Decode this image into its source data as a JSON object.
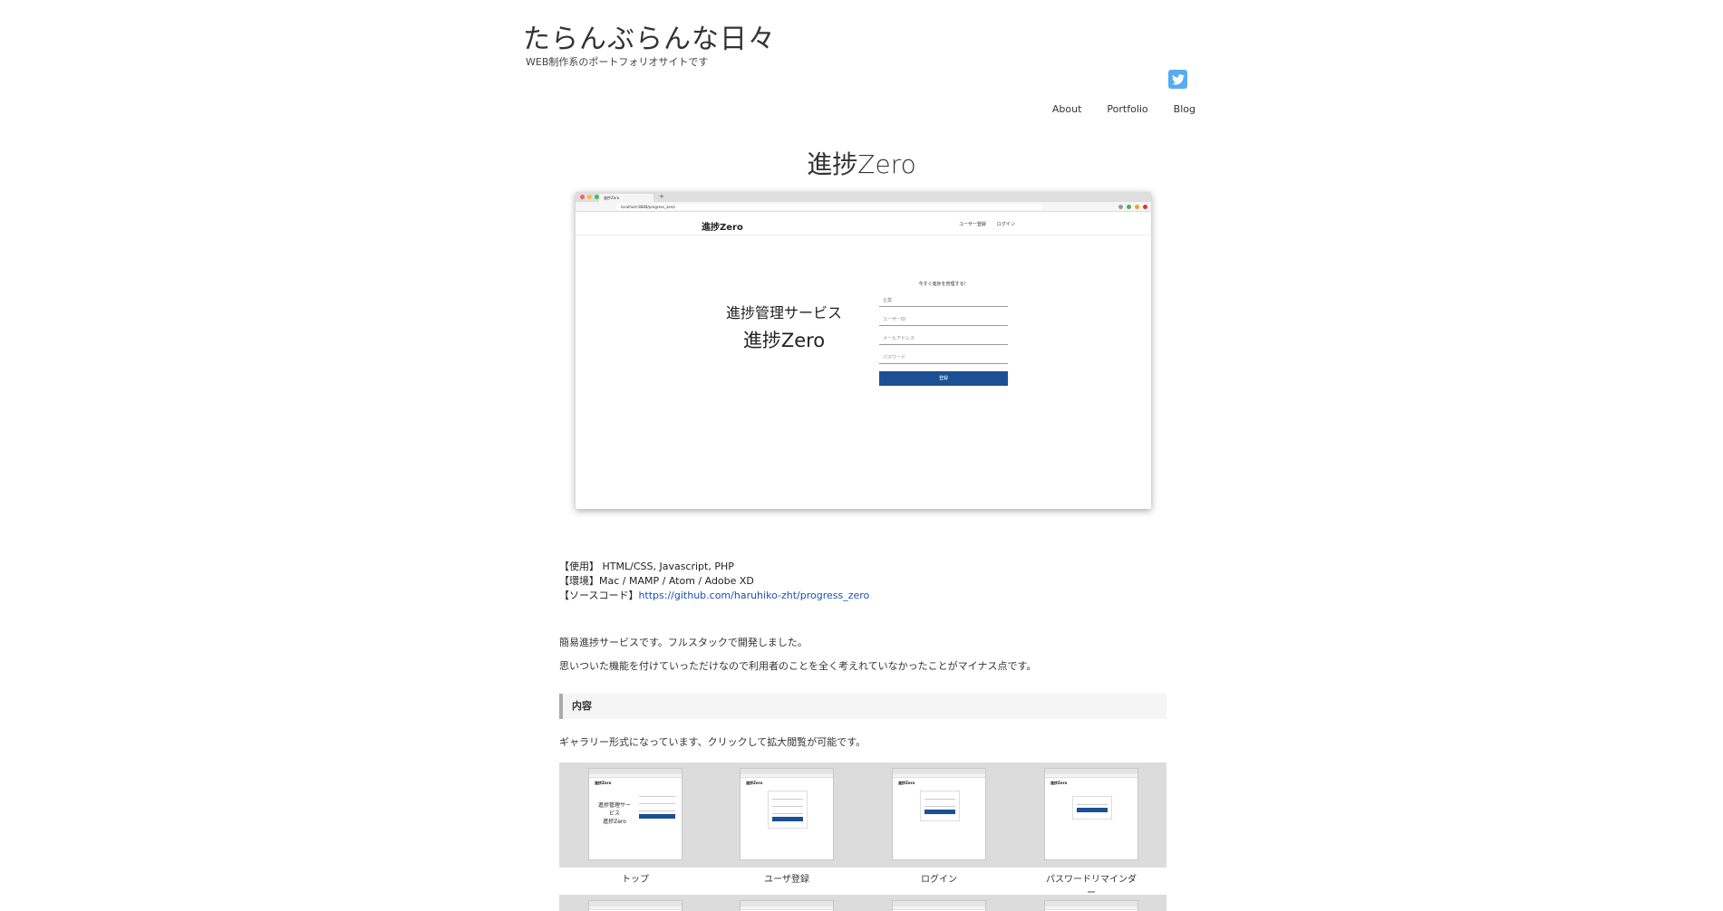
{
  "site": {
    "title": "たらんぶらんな日々",
    "description": "WEB制作系のポートフォリオサイトです"
  },
  "social": {
    "twitter_icon": "twitter-icon",
    "color": "#55acee"
  },
  "nav": {
    "items": [
      {
        "label": "About"
      },
      {
        "label": "Portfolio"
      },
      {
        "label": "Blog"
      }
    ]
  },
  "page": {
    "title": "進捗Zero"
  },
  "hero": {
    "tab_title": "進捗Zero",
    "url": "localhost:8888/progress_zero/",
    "app_logo": "進捗Zero",
    "app_nav": [
      "ユーザー登録",
      "ログイン"
    ],
    "subtitle": "進捗管理サービス",
    "headline": "進捗Zero",
    "form_title": "今すぐ進捗を管理する！",
    "fields": [
      "企業",
      "ユーザーID",
      "メールアドレス",
      "パスワード"
    ],
    "submit_label": "登録"
  },
  "meta": {
    "used_label": "【使用】",
    "used_value": "HTML/CSS, Javascript, PHP",
    "env_label": "【環境】",
    "env_value": "Mac / MAMP / Atom / Adobe XD",
    "source_label": "【ソースコード】",
    "source_url": "https://github.com/haruhiko-zht/progress_zero"
  },
  "description": {
    "line1": "簡易進捗サービスです。フルスタックで開発しました。",
    "line2": "思いついた機能を付けていっただけなので利用者のことを全く考えれていなかったことがマイナス点です。"
  },
  "section": {
    "heading": "内容",
    "gallery_note": "ギャラリー形式になっています、クリックして拡大閲覧が可能です。"
  },
  "gallery": {
    "items": [
      {
        "label": "トップ"
      },
      {
        "label": "ユーザ登録"
      },
      {
        "label": "ログイン"
      },
      {
        "label": "パスワードリマインダー"
      }
    ]
  },
  "colors": {
    "accent": "#1c4f93",
    "link": "#1a4fb5",
    "gallery_bg": "#dcdcdc"
  }
}
